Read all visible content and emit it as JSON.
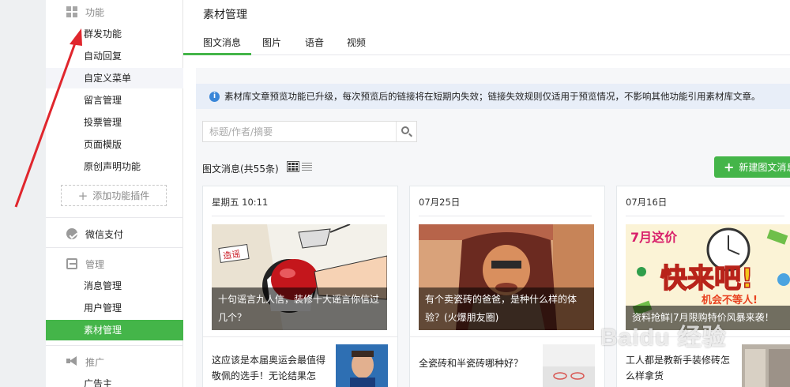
{
  "sidebar": {
    "section_function": "功能",
    "function_items": [
      "群发功能",
      "自动回复",
      "自定义菜单",
      "留言管理",
      "投票管理",
      "页面模版",
      "原创声明功能"
    ],
    "add_plugin": "添加功能插件",
    "section_pay": "微信支付",
    "section_manage": "管理",
    "manage_items": [
      "消息管理",
      "用户管理",
      "素材管理"
    ],
    "section_promo": "推广",
    "promo_items": [
      "广告主"
    ]
  },
  "header": {
    "title": "素材管理"
  },
  "tabs": [
    "图文消息",
    "图片",
    "语音",
    "视频"
  ],
  "notice": {
    "text": "素材库文章预览功能已升级，每次预览后的链接将在短期内失效；链接失效规则仅适用于预览情况，不影响其他功能引用素材库文章。"
  },
  "search": {
    "placeholder": "标题/作者/摘要"
  },
  "list": {
    "count_label": "图文消息(共55条)",
    "new_button": "新建图文消息"
  },
  "cards": [
    {
      "date": "星期五 10:11",
      "cover_title": "十句谣言九人信，装修十大谣言你信过几个？",
      "sub_title": "这应该是本届奥运会最值得敬佩的选手！无论结果怎",
      "cover_text": "造谣"
    },
    {
      "date": "07月25日",
      "cover_title": "有个卖瓷砖的爸爸，是种什么样的体验？(火爆朋友圈)",
      "sub_title": "全瓷砖和半瓷砖哪种好？"
    },
    {
      "date": "07月16日",
      "cover_title": "资料抢鲜|7月限购特价风暴来袭！",
      "sub_title": "工人都是教新手装修砖怎么样拿货",
      "cover_text": "快来吧!",
      "cover_subtext": "机会不等人!",
      "cover_badge": "7月这价"
    }
  ],
  "watermark": "Baidu 经验",
  "colors": {
    "accent": "#44b549",
    "notice_bg": "#e8eef8",
    "info": "#3a86d8"
  },
  "icons": [
    "grid-icon",
    "pay-icon",
    "manage-icon",
    "promo-icon",
    "info-icon",
    "search-icon",
    "grid-view-icon",
    "list-view-icon",
    "plus-icon"
  ]
}
